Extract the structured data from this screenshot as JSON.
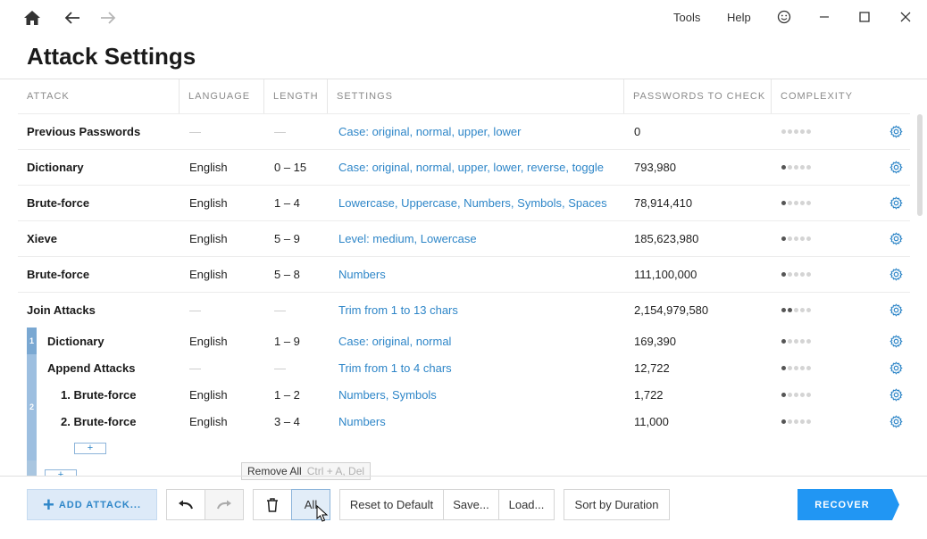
{
  "menu": {
    "tools": "Tools",
    "help": "Help"
  },
  "page": {
    "title": "Attack Settings"
  },
  "columns": [
    "ATTACK",
    "LANGUAGE",
    "LENGTH",
    "SETTINGS",
    "PASSWORDS TO CHECK",
    "COMPLEXITY"
  ],
  "rows": [
    {
      "attack": "Previous Passwords",
      "language": "—",
      "length": "—",
      "settings": "Case: original, normal, upper, lower",
      "passwords": "0",
      "complexity": 0
    },
    {
      "attack": "Dictionary",
      "language": "English",
      "length": "0 – 15",
      "settings": "Case: original, normal, upper, lower, reverse, toggle",
      "passwords": "793,980",
      "complexity": 1
    },
    {
      "attack": "Brute-force",
      "language": "English",
      "length": "1 – 4",
      "settings": "Lowercase, Uppercase, Numbers, Symbols, Spaces",
      "passwords": "78,914,410",
      "complexity": 1
    },
    {
      "attack": "Xieve",
      "language": "English",
      "length": "5 – 9",
      "settings": "Level: medium, Lowercase",
      "passwords": "185,623,980",
      "complexity": 1
    },
    {
      "attack": "Brute-force",
      "language": "English",
      "length": "5 – 8",
      "settings": "Numbers",
      "passwords": "111,100,000",
      "complexity": 1
    },
    {
      "attack": "Join Attacks",
      "language": "—",
      "length": "—",
      "settings": "Trim from 1 to 13 chars",
      "passwords": "2,154,979,580",
      "complexity": 2
    },
    {
      "attack": "Dictionary",
      "language": "English",
      "length": "1 – 9",
      "settings": "Case: original, normal",
      "passwords": "169,390",
      "complexity": 1
    },
    {
      "attack": "Append Attacks",
      "language": "—",
      "length": "—",
      "settings": "Trim from 1 to 4 chars",
      "passwords": "12,722",
      "complexity": 1
    },
    {
      "attack": "1. Brute-force",
      "language": "English",
      "length": "1 – 2",
      "settings": "Numbers, Symbols",
      "passwords": "1,722",
      "complexity": 1
    },
    {
      "attack": "2. Brute-force",
      "language": "English",
      "length": "3 – 4",
      "settings": "Numbers",
      "passwords": "11,000",
      "complexity": 1
    }
  ],
  "nest": {
    "n1": "1",
    "n2": "2",
    "plus": "+"
  },
  "tooltip": {
    "label": "Remove All",
    "shortcut": "Ctrl + A, Del"
  },
  "toolbar": {
    "add_attack": "ADD ATTACK...",
    "all": "All",
    "reset": "Reset to Default",
    "save": "Save...",
    "load": "Load...",
    "sort": "Sort by Duration",
    "recover": "RECOVER"
  },
  "colors": {
    "accent": "#2e86c8",
    "recover": "#2196f3"
  }
}
